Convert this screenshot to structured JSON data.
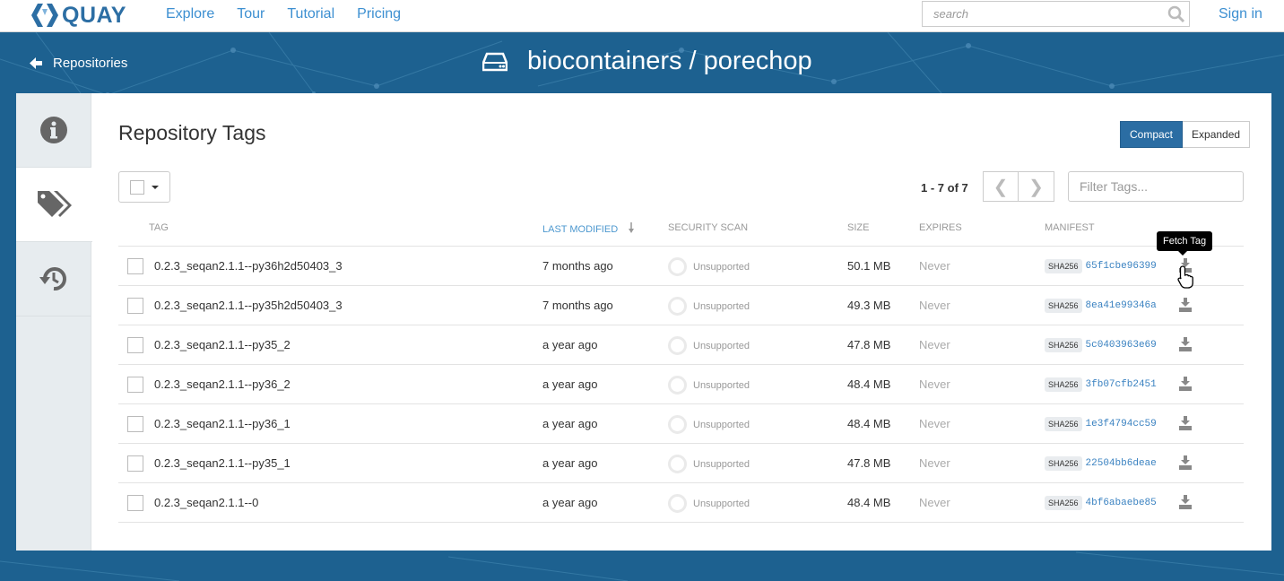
{
  "nav": {
    "brand": "QUAY",
    "links": [
      "Explore",
      "Tour",
      "Tutorial",
      "Pricing"
    ],
    "search_placeholder": "search",
    "signin": "Sign in"
  },
  "header": {
    "back_label": "Repositories",
    "repo_title": "biocontainers / porechop"
  },
  "main": {
    "heading": "Repository Tags",
    "view_modes": [
      "Compact",
      "Expanded"
    ],
    "active_view": "Compact",
    "pagination": "1 - 7 of 7",
    "filter_placeholder": "Filter Tags..."
  },
  "table": {
    "columns": {
      "tag": "TAG",
      "last_modified": "LAST MODIFIED",
      "security_scan": "SECURITY SCAN",
      "size": "SIZE",
      "expires": "EXPIRES",
      "manifest": "MANIFEST"
    },
    "sha_label": "SHA256",
    "rows": [
      {
        "tag": "0.2.3_seqan2.1.1--py36h2d50403_3",
        "modified": "7 months ago",
        "scan": "Unsupported",
        "size": "50.1 MB",
        "expires": "Never",
        "digest": "65f1cbe96399"
      },
      {
        "tag": "0.2.3_seqan2.1.1--py35h2d50403_3",
        "modified": "7 months ago",
        "scan": "Unsupported",
        "size": "49.3 MB",
        "expires": "Never",
        "digest": "8ea41e99346a"
      },
      {
        "tag": "0.2.3_seqan2.1.1--py35_2",
        "modified": "a year ago",
        "scan": "Unsupported",
        "size": "47.8 MB",
        "expires": "Never",
        "digest": "5c0403963e69"
      },
      {
        "tag": "0.2.3_seqan2.1.1--py36_2",
        "modified": "a year ago",
        "scan": "Unsupported",
        "size": "48.4 MB",
        "expires": "Never",
        "digest": "3fb07cfb2451"
      },
      {
        "tag": "0.2.3_seqan2.1.1--py36_1",
        "modified": "a year ago",
        "scan": "Unsupported",
        "size": "48.4 MB",
        "expires": "Never",
        "digest": "1e3f4794cc59"
      },
      {
        "tag": "0.2.3_seqan2.1.1--py35_1",
        "modified": "a year ago",
        "scan": "Unsupported",
        "size": "47.8 MB",
        "expires": "Never",
        "digest": "22504bb6deae"
      },
      {
        "tag": "0.2.3_seqan2.1.1--0",
        "modified": "a year ago",
        "scan": "Unsupported",
        "size": "48.4 MB",
        "expires": "Never",
        "digest": "4bf6abaebe85"
      }
    ]
  },
  "tooltip": "Fetch Tag",
  "icons": {
    "logo": "quay-logo-icon",
    "search": "search-icon",
    "back": "arrow-left-icon",
    "repo": "hard-drive-icon",
    "info_tab": "info-circle-icon",
    "tags_tab": "tags-icon",
    "history_tab": "history-icon",
    "download": "download-icon"
  },
  "colors": {
    "brand": "#2c6ea4",
    "link": "#3c8fd1",
    "header_bg": "#1b5f8e",
    "toggle_active": "#2b6da3"
  }
}
